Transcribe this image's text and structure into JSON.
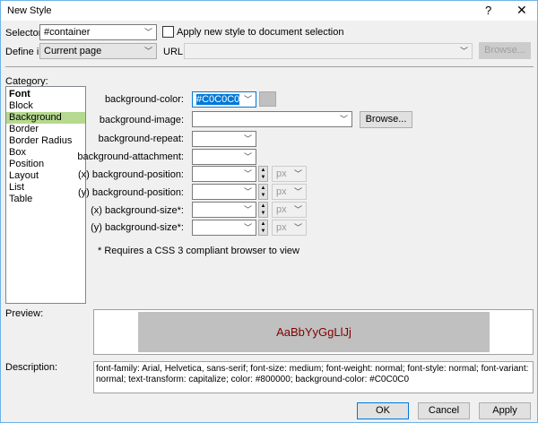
{
  "title": "New Style",
  "help": "?",
  "close": "✕",
  "selector": {
    "label": "Selector:",
    "value": "#container"
  },
  "apply_checkbox": {
    "label": "Apply new style to document selection",
    "checked": false
  },
  "define_in": {
    "label": "Define in:",
    "value": "Current page"
  },
  "url": {
    "label": "URL:",
    "value": "",
    "browse": "Browse..."
  },
  "category": {
    "label": "Category:",
    "items": [
      "Font",
      "Block",
      "Background",
      "Border",
      "Border Radius",
      "Box",
      "Position",
      "Layout",
      "List",
      "Table"
    ],
    "selected": "Background"
  },
  "fields": {
    "bg_color": {
      "label": "background-color:",
      "value": "#C0C0C0",
      "swatch": "#C0C0C0"
    },
    "bg_image": {
      "label": "background-image:",
      "value": "",
      "browse": "Browse..."
    },
    "bg_repeat": {
      "label": "background-repeat:",
      "value": ""
    },
    "bg_attachment": {
      "label": "background-attachment:",
      "value": ""
    },
    "pos_x": {
      "label": "(x) background-position:",
      "value": "",
      "unit": "px"
    },
    "pos_y": {
      "label": "(y) background-position:",
      "value": "",
      "unit": "px"
    },
    "size_x": {
      "label": "(x) background-size*:",
      "value": "",
      "unit": "px"
    },
    "size_y": {
      "label": "(y) background-size*:",
      "value": "",
      "unit": "px"
    }
  },
  "note": "* Requires a CSS 3 compliant browser to view",
  "preview": {
    "label": "Preview:",
    "text": "AaBbYyGgLlJj",
    "text_color": "#800000",
    "bg": "#C0C0C0"
  },
  "description": {
    "label": "Description:",
    "text": "font-family: Arial, Helvetica, sans-serif; font-size: medium; font-weight: normal; font-style: normal; font-variant: normal; text-transform: capitalize; color: #800000; background-color: #C0C0C0"
  },
  "buttons": {
    "ok": "OK",
    "cancel": "Cancel",
    "apply": "Apply"
  }
}
